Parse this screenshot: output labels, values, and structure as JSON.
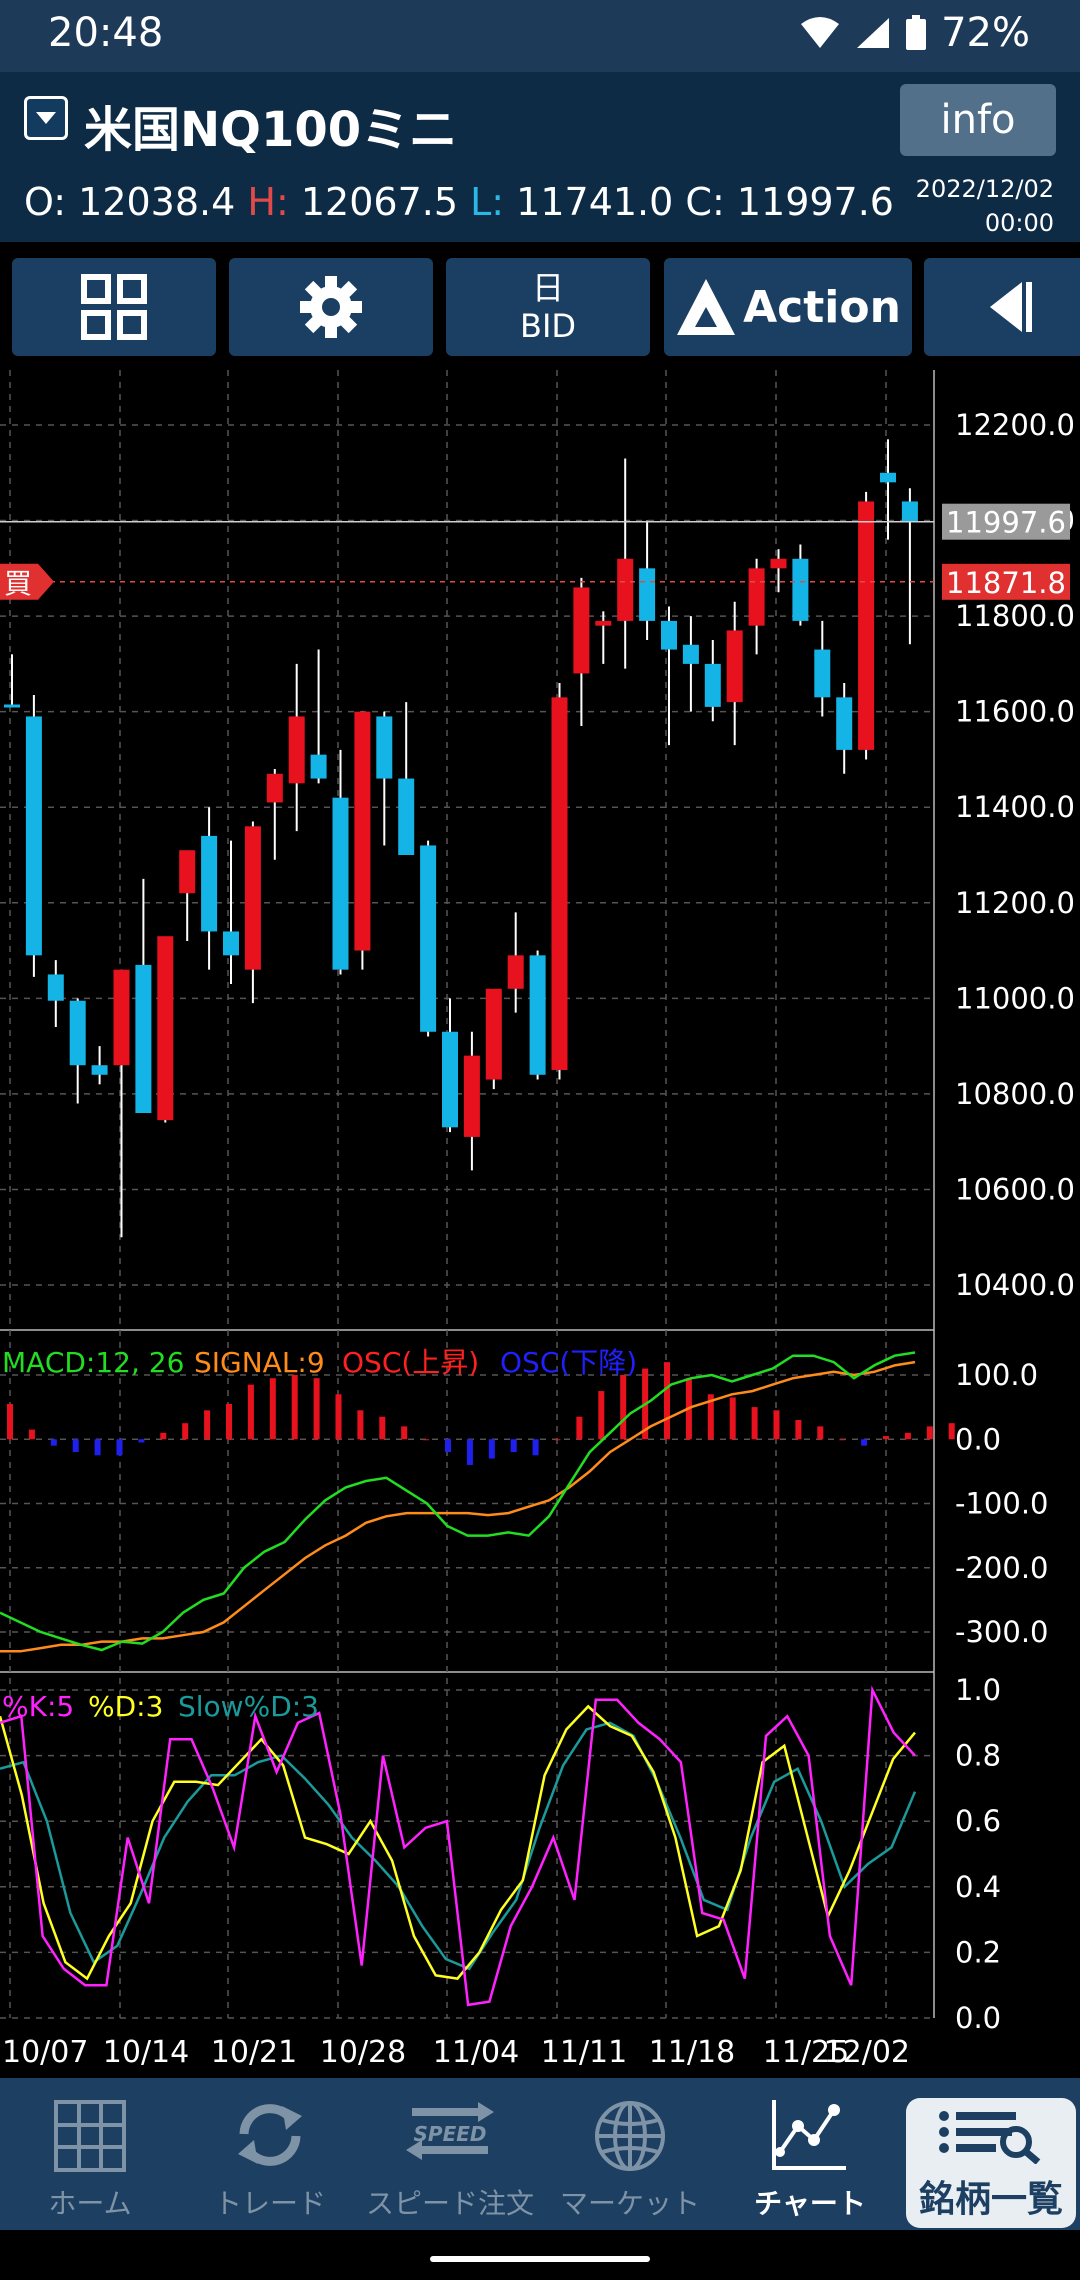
{
  "status": {
    "time": "20:48",
    "battery": "72%"
  },
  "header": {
    "title": "米国NQ100ミニ",
    "info_label": "info",
    "open_label": "O:",
    "open": "12038.4",
    "high_label": "H:",
    "high": "12067.5",
    "low_label": "L:",
    "low": "11741.0",
    "close_label": "C:",
    "close": "11997.6",
    "date": "2022/12/02",
    "time": "00:00"
  },
  "toolbar": {
    "period_label": "日",
    "price_type": "BID",
    "action_label": "Action"
  },
  "colors": {
    "bull": "#e8121f",
    "bear": "#14b4e6",
    "macd": "#22dd22",
    "signal": "#ff8c1a",
    "k": "#ff22ff",
    "d": "#ffff22",
    "slowd": "#1a9a9a",
    "nav_bg": "#1d3f62"
  },
  "chart_data": [
    {
      "type": "candlestick",
      "instrument": "米国NQ100ミニ",
      "y_ticks": [
        "12200.0",
        "12000.0",
        "11800.0",
        "11600.0",
        "11400.0",
        "11200.0",
        "11000.0",
        "10800.0",
        "10600.0",
        "10400.0"
      ],
      "ylim": [
        10350,
        12400
      ],
      "x_ticks": [
        "10/07",
        "10/14",
        "10/21",
        "10/28",
        "11/04",
        "11/11",
        "11/18",
        "11/25",
        "12/02"
      ],
      "current_price": "11997.6",
      "buy_price": "11871.8",
      "buy_label": "買",
      "candles": [
        {
          "o": 11615,
          "h": 11720,
          "l": 11610,
          "c": 11610
        },
        {
          "o": 11590,
          "h": 11635,
          "l": 11045,
          "c": 11090
        },
        {
          "o": 11050,
          "h": 11080,
          "l": 10940,
          "c": 10995
        },
        {
          "o": 10995,
          "h": 11000,
          "l": 10780,
          "c": 10860
        },
        {
          "o": 10860,
          "h": 10900,
          "l": 10820,
          "c": 10840
        },
        {
          "o": 10860,
          "h": 11060,
          "l": 10500,
          "c": 11060
        },
        {
          "o": 11070,
          "h": 11250,
          "l": 10770,
          "c": 10760
        },
        {
          "o": 10745,
          "h": 11100,
          "l": 10740,
          "c": 11130
        },
        {
          "o": 11220,
          "h": 11280,
          "l": 11120,
          "c": 11310
        },
        {
          "o": 11340,
          "h": 11400,
          "l": 11060,
          "c": 11140
        },
        {
          "o": 11140,
          "h": 11330,
          "l": 11030,
          "c": 11090
        },
        {
          "o": 11060,
          "h": 11370,
          "l": 10990,
          "c": 11360
        },
        {
          "o": 11410,
          "h": 11480,
          "l": 11290,
          "c": 11470
        },
        {
          "o": 11450,
          "h": 11700,
          "l": 11350,
          "c": 11590
        },
        {
          "o": 11510,
          "h": 11730,
          "l": 11450,
          "c": 11460
        },
        {
          "o": 11420,
          "h": 11520,
          "l": 11050,
          "c": 11060
        },
        {
          "o": 11100,
          "h": 11600,
          "l": 11060,
          "c": 11600
        },
        {
          "o": 11590,
          "h": 11600,
          "l": 11320,
          "c": 11460
        },
        {
          "o": 11460,
          "h": 11620,
          "l": 11310,
          "c": 11300
        },
        {
          "o": 11320,
          "h": 11330,
          "l": 10920,
          "c": 10930
        },
        {
          "o": 10930,
          "h": 11000,
          "l": 10720,
          "c": 10730
        },
        {
          "o": 10710,
          "h": 10930,
          "l": 10640,
          "c": 10880
        },
        {
          "o": 10830,
          "h": 11010,
          "l": 10810,
          "c": 11020
        },
        {
          "o": 11020,
          "h": 11180,
          "l": 10970,
          "c": 11090
        },
        {
          "o": 11090,
          "h": 11100,
          "l": 10830,
          "c": 10840
        },
        {
          "o": 10850,
          "h": 11660,
          "l": 10830,
          "c": 11630
        },
        {
          "o": 11680,
          "h": 11880,
          "l": 11570,
          "c": 11860
        },
        {
          "o": 11780,
          "h": 11810,
          "l": 11700,
          "c": 11790
        },
        {
          "o": 11790,
          "h": 12130,
          "l": 11690,
          "c": 11920
        },
        {
          "o": 11900,
          "h": 12000,
          "l": 11750,
          "c": 11790
        },
        {
          "o": 11790,
          "h": 11820,
          "l": 11530,
          "c": 11730
        },
        {
          "o": 11740,
          "h": 11800,
          "l": 11600,
          "c": 11700
        },
        {
          "o": 11700,
          "h": 11750,
          "l": 11580,
          "c": 11610
        },
        {
          "o": 11620,
          "h": 11830,
          "l": 11530,
          "c": 11770
        },
        {
          "o": 11780,
          "h": 11920,
          "l": 11720,
          "c": 11900
        },
        {
          "o": 11900,
          "h": 11940,
          "l": 11850,
          "c": 11920
        },
        {
          "o": 11920,
          "h": 11950,
          "l": 11780,
          "c": 11790
        },
        {
          "o": 11730,
          "h": 11790,
          "l": 11590,
          "c": 11630
        },
        {
          "o": 11630,
          "h": 11660,
          "l": 11470,
          "c": 11520
        },
        {
          "o": 11520,
          "h": 12060,
          "l": 11500,
          "c": 12040
        },
        {
          "o": 12100,
          "h": 12170,
          "l": 11960,
          "c": 12080
        },
        {
          "o": 12040,
          "h": 12067.5,
          "l": 11741,
          "c": 11997.6
        }
      ]
    },
    {
      "type": "bar",
      "name": "MACD",
      "legend": [
        "MACD:12, 26",
        "SIGNAL:9",
        "OSC(上昇)",
        "OSC(下降)"
      ],
      "y_ticks": [
        "100.0",
        "0.0",
        "-100.0",
        "-200.0",
        "-300.0"
      ],
      "ylim": [
        -360,
        160
      ],
      "macd": [
        -270,
        -285,
        -300,
        -310,
        -320,
        -328,
        -315,
        -318,
        -300,
        -270,
        -250,
        -240,
        -200,
        -175,
        -160,
        -125,
        -95,
        -75,
        -65,
        -60,
        -80,
        -100,
        -135,
        -150,
        -150,
        -145,
        -150,
        -120,
        -70,
        -20,
        10,
        40,
        60,
        85,
        95,
        100,
        90,
        100,
        110,
        130,
        130,
        120,
        95,
        115,
        130,
        135
      ],
      "signal": [
        -330,
        -330,
        -325,
        -320,
        -320,
        -315,
        -315,
        -310,
        -310,
        -305,
        -300,
        -285,
        -260,
        -235,
        -210,
        -185,
        -165,
        -150,
        -130,
        -120,
        -115,
        -115,
        -115,
        -115,
        -118,
        -115,
        -105,
        -95,
        -75,
        -50,
        -20,
        0,
        20,
        35,
        50,
        60,
        70,
        75,
        85,
        95,
        100,
        105,
        100,
        105,
        115,
        120
      ],
      "osc": [
        55,
        15,
        -10,
        -20,
        -25,
        -25,
        -5,
        10,
        25,
        45,
        55,
        85,
        95,
        100,
        95,
        70,
        45,
        35,
        20,
        0,
        -20,
        -40,
        -30,
        -20,
        -25,
        0,
        35,
        75,
        100,
        110,
        120,
        95,
        70,
        65,
        50,
        45,
        30,
        20,
        0,
        -10,
        5,
        10,
        20,
        25
      ]
    },
    {
      "type": "line",
      "name": "Stochastics",
      "legend": [
        "%K:5",
        "%D:3",
        "Slow%D:3"
      ],
      "y_ticks": [
        "1.0",
        "0.8",
        "0.6",
        "0.4",
        "0.2",
        "0.0"
      ],
      "ylim": [
        0,
        1
      ],
      "k": [
        0.9,
        0.92,
        0.25,
        0.15,
        0.1,
        0.1,
        0.55,
        0.35,
        0.85,
        0.85,
        0.7,
        0.52,
        0.92,
        0.75,
        0.9,
        0.93,
        0.62,
        0.16,
        0.8,
        0.52,
        0.58,
        0.6,
        0.04,
        0.05,
        0.28,
        0.4,
        0.55,
        0.36,
        0.97,
        0.97,
        0.9,
        0.85,
        0.78,
        0.32,
        0.3,
        0.12,
        0.86,
        0.92,
        0.8,
        0.25,
        0.1,
        1.0,
        0.87,
        0.8
      ],
      "d": [
        0.92,
        0.68,
        0.35,
        0.17,
        0.12,
        0.25,
        0.35,
        0.6,
        0.72,
        0.72,
        0.71,
        0.78,
        0.85,
        0.77,
        0.55,
        0.53,
        0.5,
        0.6,
        0.48,
        0.25,
        0.13,
        0.12,
        0.2,
        0.33,
        0.42,
        0.74,
        0.88,
        0.95,
        0.89,
        0.86,
        0.75,
        0.55,
        0.25,
        0.28,
        0.45,
        0.78,
        0.83,
        0.57,
        0.31,
        0.45,
        0.62,
        0.79,
        0.87
      ],
      "slowd": [
        0.76,
        0.78,
        0.6,
        0.32,
        0.17,
        0.22,
        0.38,
        0.55,
        0.66,
        0.74,
        0.74,
        0.78,
        0.8,
        0.73,
        0.65,
        0.55,
        0.48,
        0.4,
        0.28,
        0.18,
        0.15,
        0.26,
        0.36,
        0.58,
        0.77,
        0.88,
        0.9,
        0.86,
        0.72,
        0.55,
        0.36,
        0.33,
        0.55,
        0.72,
        0.76,
        0.6,
        0.4,
        0.47,
        0.52,
        0.69
      ]
    }
  ],
  "nav": {
    "home": "ホーム",
    "trade": "トレード",
    "speed": "スピード注文",
    "speed_badge": "SPEED",
    "market": "マーケット",
    "chart": "チャート",
    "list": "銘柄一覧"
  }
}
